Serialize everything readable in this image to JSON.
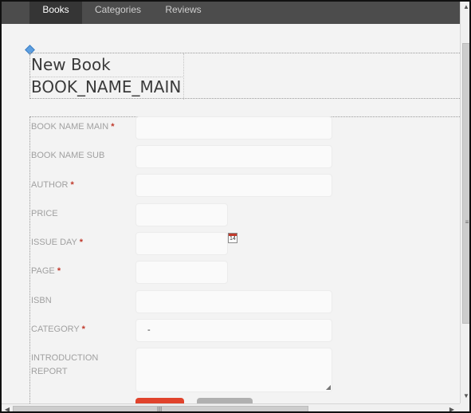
{
  "nav": {
    "tabs": [
      {
        "label": "Books",
        "active": true
      },
      {
        "label": "Categories",
        "active": false
      },
      {
        "label": "Reviews",
        "active": false
      }
    ]
  },
  "header": {
    "title": "New Book",
    "subtitle": "BOOK_NAME_MAIN"
  },
  "form": {
    "required_mark": "*",
    "fields": [
      {
        "label": "BOOK NAME MAIN",
        "required": true,
        "value": ""
      },
      {
        "label": "BOOK NAME SUB",
        "required": false,
        "value": ""
      },
      {
        "label": "AUTHOR",
        "required": true,
        "value": ""
      },
      {
        "label": "PRICE",
        "required": false,
        "value": ""
      },
      {
        "label": "ISSUE DAY",
        "required": true,
        "value": ""
      },
      {
        "label": "PAGE",
        "required": true,
        "value": ""
      },
      {
        "label": "ISBN",
        "required": false,
        "value": ""
      },
      {
        "label": "CATEGORY",
        "required": true,
        "value": "-"
      },
      {
        "label": "INTRODUCTION REPORT",
        "required": false,
        "value": ""
      }
    ],
    "calendar_icon": "calendar-icon",
    "calendar_day": "14"
  },
  "colors": {
    "nav_bg": "#4c4c4c",
    "nav_active_bg": "#353535",
    "required": "#c0392b",
    "save_button": "#e0432c",
    "cancel_button": "#b0b0b0"
  }
}
